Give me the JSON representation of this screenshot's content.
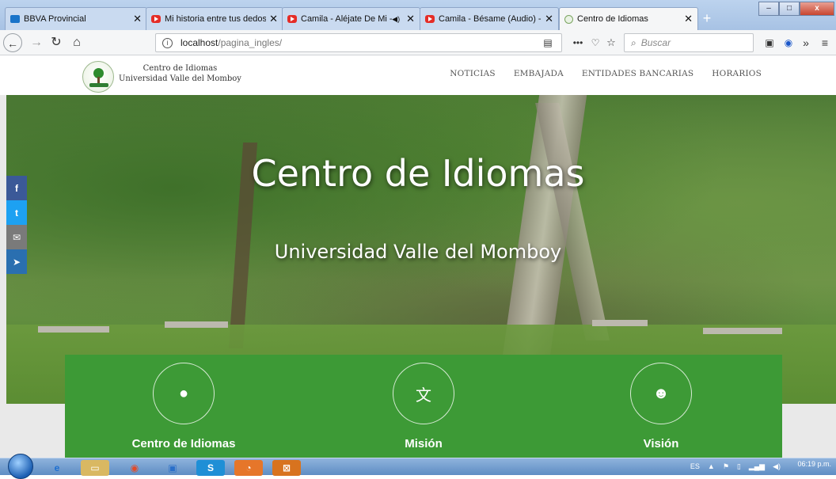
{
  "browser": {
    "tabs": [
      {
        "label": "BBVA Provincial",
        "favicon": "bank-icon"
      },
      {
        "label": "Mi historia entre tus dedos - Yo",
        "favicon": "youtube-icon"
      },
      {
        "label": "Camila - Aléjate De Mi - Yo",
        "favicon": "youtube-icon"
      },
      {
        "label": "Camila - Bésame (Audio) - You",
        "favicon": "youtube-icon"
      },
      {
        "label": "Centro de Idiomas",
        "favicon": "site-icon"
      }
    ],
    "url_host": "localhost",
    "url_path": "/pagina_ingles/",
    "search_placeholder": "Buscar",
    "window_controls": {
      "minimize": "–",
      "maximize": "□",
      "close": "x"
    }
  },
  "site": {
    "brand_line1": "Centro de Idiomas",
    "brand_line2": "Universidad Valle del Momboy",
    "nav": [
      "NOTICIAS",
      "EMBAJADA",
      "ENTIDADES BANCARIAS",
      "HORARIOS"
    ],
    "hero_title": "Centro de Idiomas",
    "hero_subtitle": "Universidad Valle del Momboy",
    "social": [
      "facebook-icon",
      "twitter-icon",
      "mail-icon",
      "telegram-icon"
    ],
    "features": [
      {
        "title": "Centro de Idiomas",
        "icon": "globe-icon"
      },
      {
        "title": "Misión",
        "icon": "translate-icon"
      },
      {
        "title": "Visión",
        "icon": "theater-masks-icon"
      }
    ],
    "colors": {
      "panel": "#3d9a36",
      "facebook": "#3b5998",
      "twitter": "#1da1f2"
    }
  },
  "taskbar": {
    "tray_lang": "ES",
    "clock_time": "06:19 p.m."
  }
}
